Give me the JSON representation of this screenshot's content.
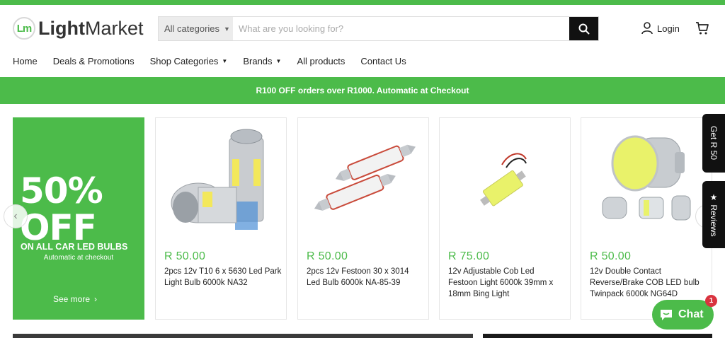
{
  "colors": {
    "brand_green": "#4cbb4a",
    "price_green": "#4cbb4a",
    "search_button": "#111111",
    "badge_red": "#d9333f"
  },
  "header": {
    "logo": {
      "mark": "Lm",
      "light": "Light",
      "market": "Market"
    },
    "search": {
      "category_label": "All categories",
      "placeholder": "What are you looking for?",
      "icon": "search-icon"
    },
    "login_label": "Login",
    "cart_icon": "cart-icon"
  },
  "nav": {
    "items": [
      {
        "label": "Home"
      },
      {
        "label": "Deals & Promotions"
      },
      {
        "label": "Shop Categories",
        "dropdown": true
      },
      {
        "label": "Brands",
        "dropdown": true
      },
      {
        "label": "All products"
      },
      {
        "label": "Contact Us"
      }
    ]
  },
  "promo_bar": {
    "text": "R100 OFF orders over R1000. Automatic at Checkout"
  },
  "banner": {
    "big_text": "50%\nOFF",
    "subtitle": "ON ALL CAR LED BULBS",
    "note": "Automatic at checkout",
    "link_label": "See more"
  },
  "products": [
    {
      "price": "R 50.00",
      "title": "2pcs 12v T10 6 x 5630 Led Park Light Bulb 6000k NA32"
    },
    {
      "price": "R 50.00",
      "title": "2pcs 12v Festoon 30 x 3014 Led Bulb 6000k NA-85-39"
    },
    {
      "price": "R 75.00",
      "title": "12v Adjustable Cob Led Festoon Light 6000k 39mm x 18mm Bing Light"
    },
    {
      "price": "R 50.00",
      "title": "12v Double Contact Reverse/Brake COB LED bulb Twinpack 6000k NG64D"
    }
  ],
  "side_tabs": {
    "reward": "Get R 50",
    "reviews": "★ Reviews"
  },
  "chat": {
    "label": "Chat",
    "badge_count": "1"
  }
}
